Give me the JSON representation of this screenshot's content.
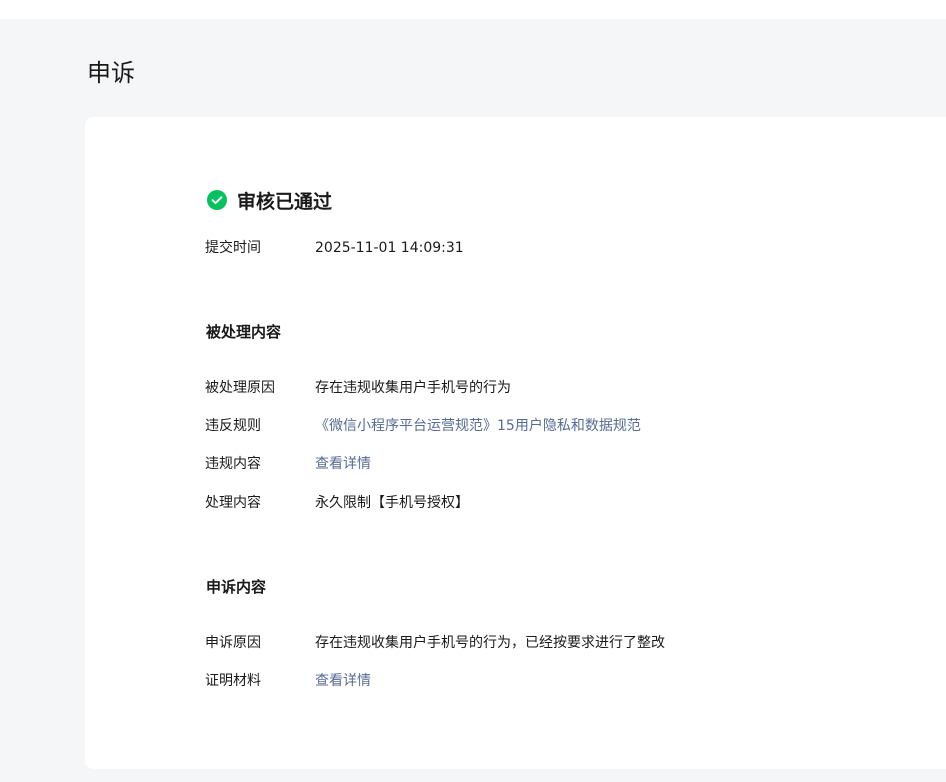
{
  "page": {
    "title": "申诉"
  },
  "status": {
    "icon": "check-circle-icon",
    "color": "#07c160",
    "text": "审核已通过"
  },
  "submission": {
    "label": "提交时间",
    "value": "2025-11-01 14:09:31"
  },
  "processed_section": {
    "title": "被处理内容",
    "rows": [
      {
        "label": "被处理原因",
        "value": "存在违规收集用户手机号的行为"
      },
      {
        "label": "违反规则",
        "value": "《微信小程序平台运营规范》15用户隐私和数据规范"
      },
      {
        "label": "违规内容",
        "value": "查看详情"
      },
      {
        "label": "处理内容",
        "value": "永久限制【手机号授权】"
      }
    ]
  },
  "appeal_section": {
    "title": "申诉内容",
    "rows": [
      {
        "label": "申诉原因",
        "value": "存在违规收集用户手机号的行为，已经按要求进行了整改"
      },
      {
        "label": "证明材料",
        "value": "查看详情"
      }
    ]
  },
  "colors": {
    "link": "#576b95",
    "success": "#07c160",
    "page_background": "#f5f6f7"
  }
}
